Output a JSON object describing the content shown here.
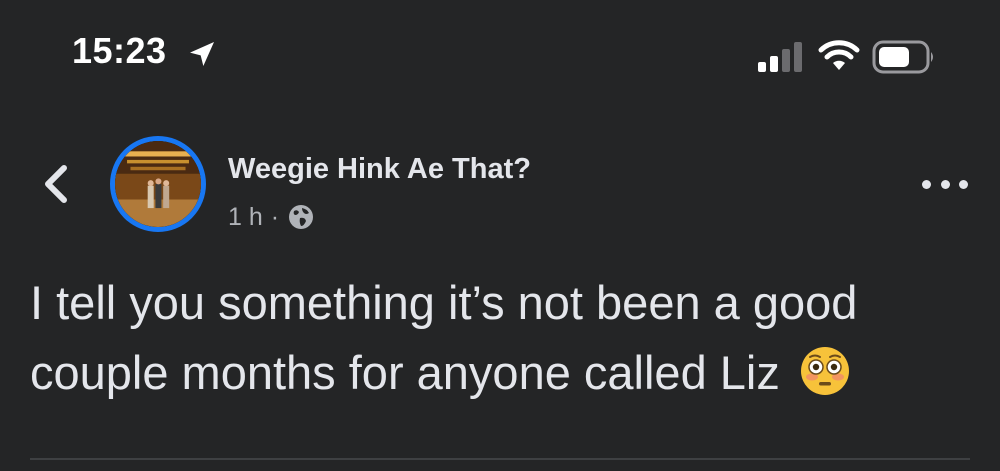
{
  "status_bar": {
    "time": "15:23"
  },
  "post": {
    "page_name": "Weegie Hink Ae That?",
    "timestamp": "1 h",
    "separator": "·",
    "text": "I tell you something it’s not been a good couple months for anyone called Liz",
    "emoji": "flushed-face"
  },
  "colors": {
    "background": "#242526",
    "text_primary": "#e4e6eb",
    "text_secondary": "#b0b3b8",
    "avatar_ring": "#1877f2"
  }
}
